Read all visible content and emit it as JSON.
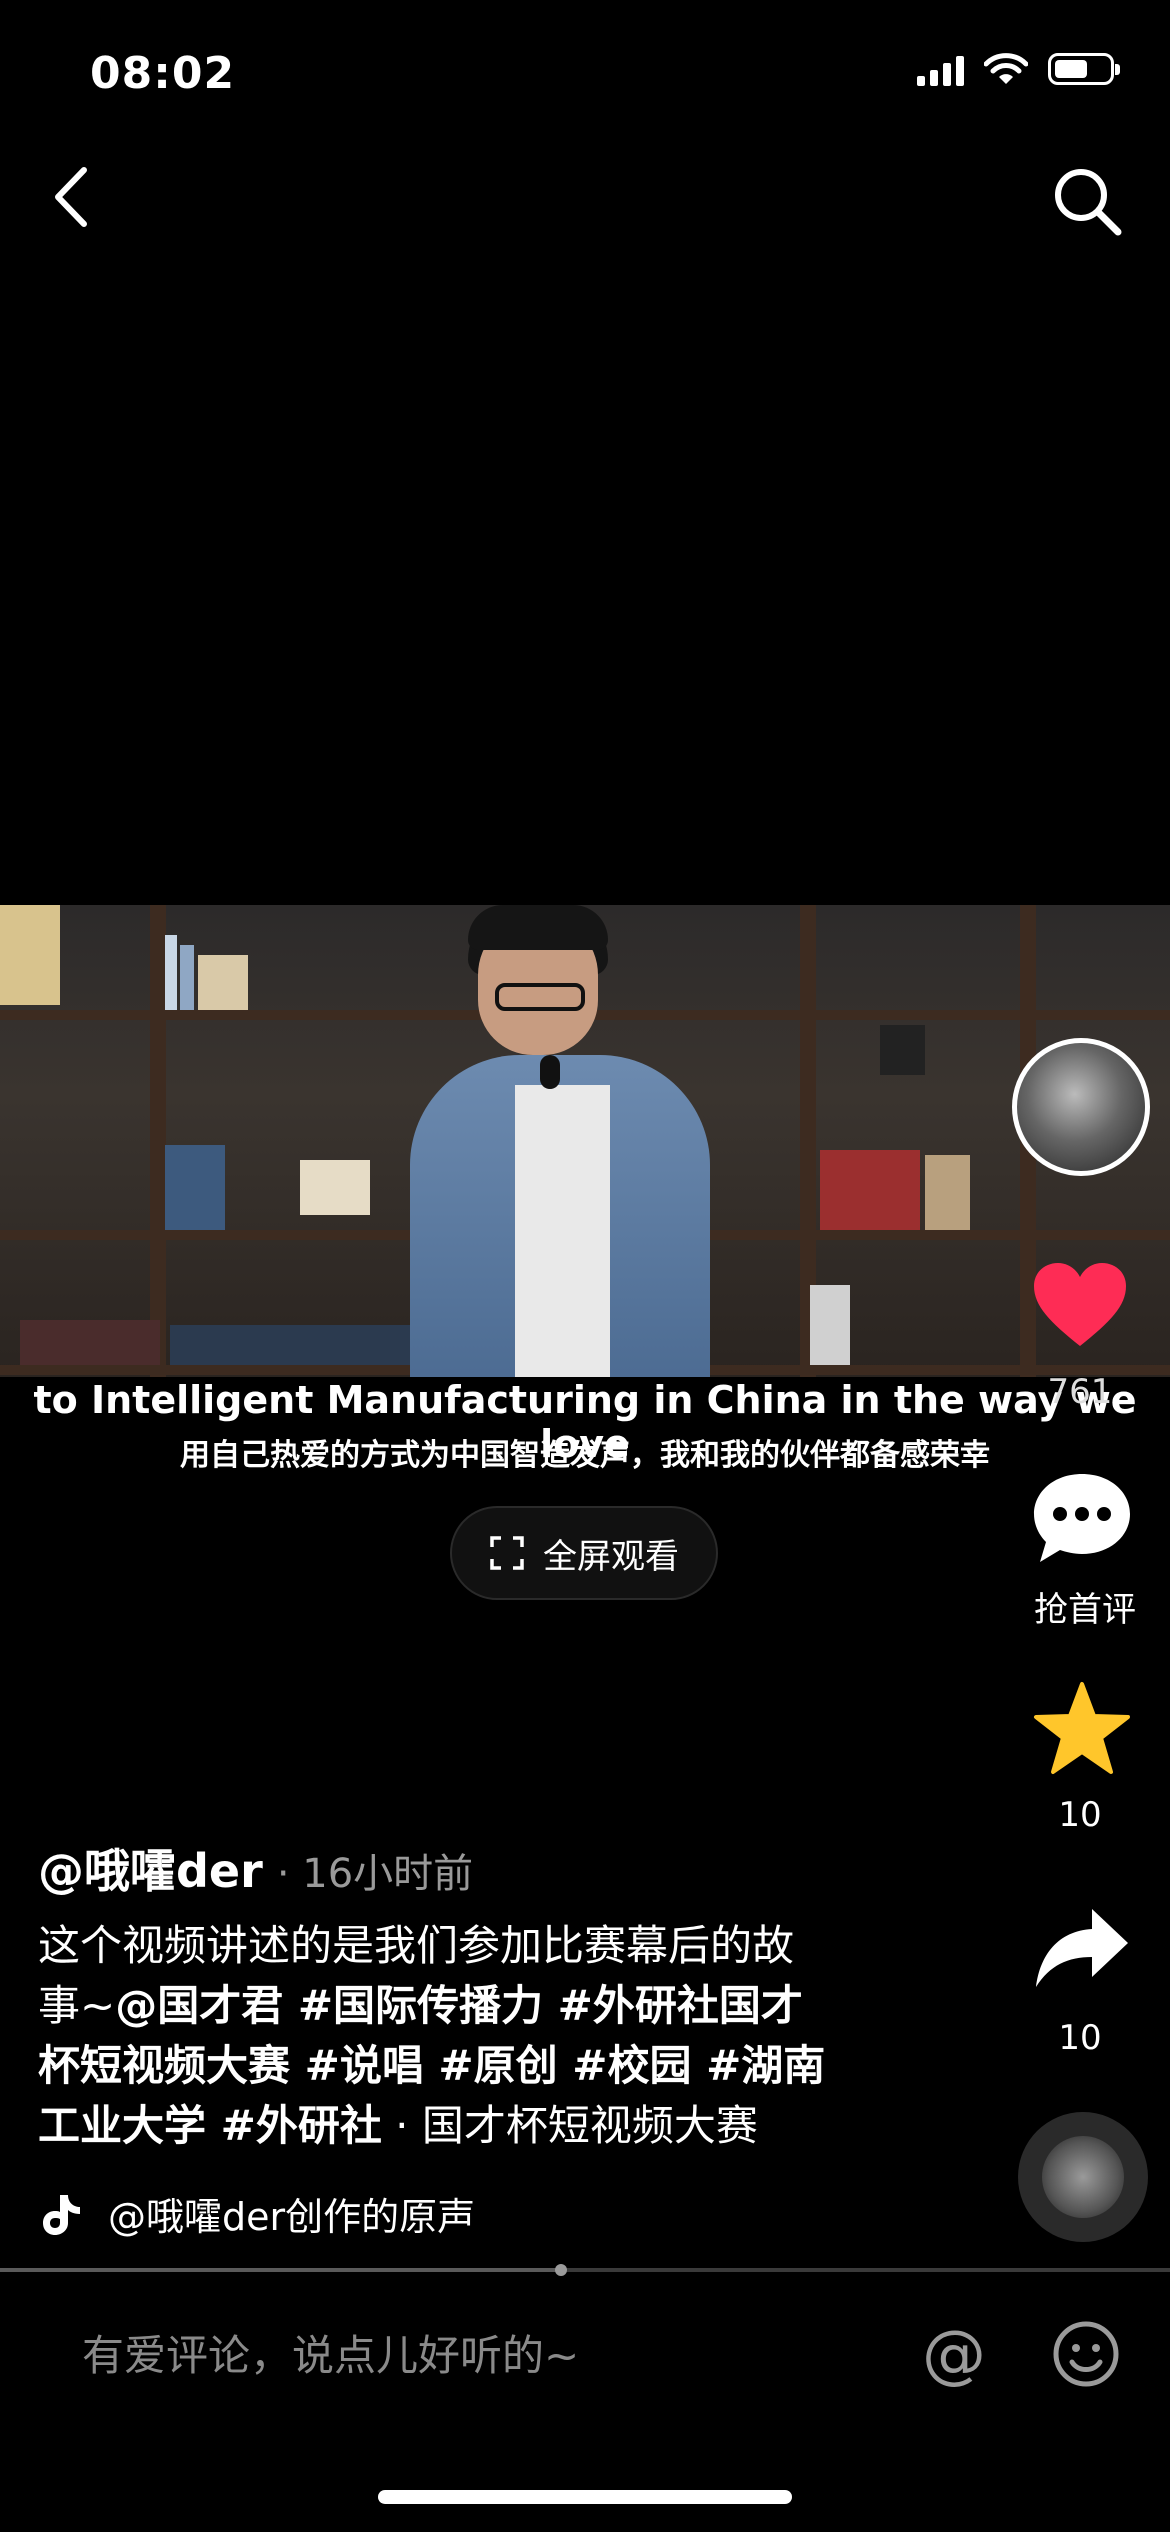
{
  "status_bar": {
    "time": "08:02",
    "battery_level": 0.6
  },
  "nav": {
    "back_icon": "chevron-left-icon",
    "search_icon": "search-icon"
  },
  "video": {
    "subtitle_en": "to Intelligent Manufacturing in China in the way we love",
    "subtitle_zh": "用自己热爱的方式为中国智造发声，我和我的伙伴都备感荣幸",
    "fullscreen_label": "全屏观看"
  },
  "actions": {
    "likes": "761",
    "comment_label": "抢首评",
    "favorites": "10",
    "shares": "10",
    "like_color": "#fe2c55",
    "favorite_color": "#ffc62b"
  },
  "post": {
    "author": "@哦嚯der",
    "time_ago": "· 16小时前",
    "desc_line1": "这个视频讲述的是我们参加比赛幕后的故",
    "desc_line2_text": "事~",
    "desc_line2_mention": "@国才君 #国际传播力 #外研社国才",
    "desc_line3": "杯短视频大赛 #说唱 #原创 #校园 #湖南",
    "desc_line4_tag": "工业大学 #外研社",
    "desc_line4_text": " · 国才杯短视频大赛",
    "music": "@哦嚯der创作的原声"
  },
  "playback": {
    "progress": 0.48
  },
  "comment_bar": {
    "placeholder": "有爱评论，说点儿好听的~"
  }
}
